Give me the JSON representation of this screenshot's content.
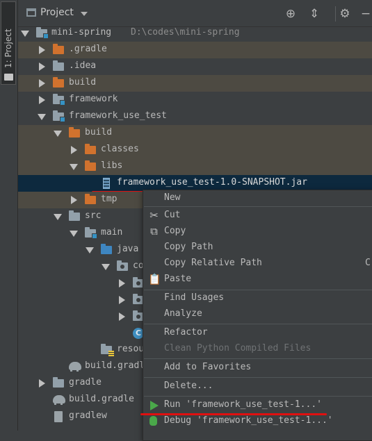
{
  "side_tab": {
    "label": "1: Project"
  },
  "toolbar": {
    "title": "Project"
  },
  "tree": [
    {
      "label": "mini-spring",
      "path": "D:\\codes\\mini-spring"
    },
    {
      "label": ".gradle"
    },
    {
      "label": ".idea"
    },
    {
      "label": "build"
    },
    {
      "label": "framework"
    },
    {
      "label": "framework_use_test"
    },
    {
      "label": "build"
    },
    {
      "label": "classes"
    },
    {
      "label": "libs"
    },
    {
      "label": "framework_use_test-1.0-SNAPSHOT.jar"
    },
    {
      "label": "tmp"
    },
    {
      "label": "src"
    },
    {
      "label": "main"
    },
    {
      "label": "java"
    },
    {
      "label": "co"
    },
    {
      "label": ""
    },
    {
      "label": ""
    },
    {
      "label": ""
    },
    {
      "label": ""
    },
    {
      "label": "resou"
    },
    {
      "label": "build.gradl"
    },
    {
      "label": "gradle"
    },
    {
      "label": "build.gradle"
    },
    {
      "label": "gradlew"
    }
  ],
  "menu": {
    "new": "New",
    "cut": "Cut",
    "copy": "Copy",
    "copy_path": "Copy Path",
    "copy_relative_path": "Copy Relative Path",
    "copy_relative_shortcut": "C",
    "paste": "Paste",
    "find_usages": "Find Usages",
    "analyze": "Analyze",
    "refactor": "Refactor",
    "clean_python": "Clean Python Compiled Files",
    "add_favorites": "Add to Favorites",
    "delete": "Delete...",
    "run": "Run 'framework_use_test-1...'",
    "debug": "Debug 'framework_use_test-1...'"
  },
  "colors": {
    "accent_red": "#e01010",
    "selection": "#0d293e",
    "excluded_bg": "#4d4a42"
  }
}
